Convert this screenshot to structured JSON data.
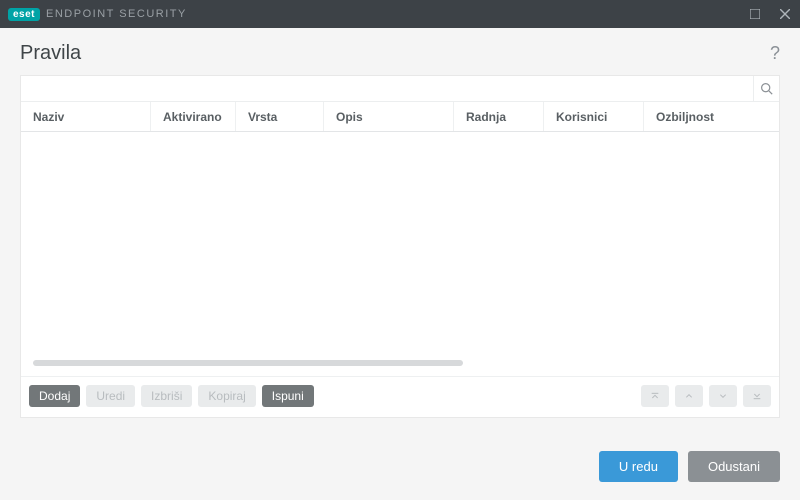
{
  "titlebar": {
    "logo": "eset",
    "product": "ENDPOINT SECURITY"
  },
  "page": {
    "title": "Pravila"
  },
  "search": {
    "value": "",
    "placeholder": ""
  },
  "columns": {
    "naziv": "Naziv",
    "aktivirano": "Aktivirano",
    "vrsta": "Vrsta",
    "opis": "Opis",
    "radnja": "Radnja",
    "korisnici": "Korisnici",
    "ozbiljnost": "Ozbiljnost"
  },
  "toolbar": {
    "dodaj": "Dodaj",
    "uredi": "Uredi",
    "izbrisi": "Izbriši",
    "kopiraj": "Kopiraj",
    "ispuni": "Ispuni"
  },
  "footer": {
    "ok": "U redu",
    "cancel": "Odustani"
  }
}
